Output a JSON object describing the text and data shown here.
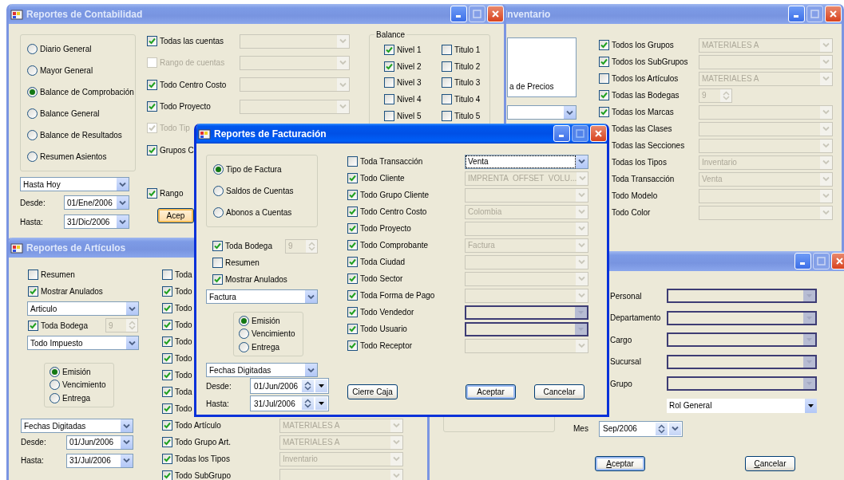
{
  "inventario_window": {
    "title": "Inventario",
    "active": false,
    "list_text": "a de Precios",
    "list_combo": {
      "disabled": false
    },
    "filters": [
      {
        "kind": "check",
        "label": "Todos los Grupos",
        "checked": true,
        "combo": {
          "value": "MATERIALES A",
          "disabled": true
        }
      },
      {
        "kind": "check",
        "label": "Todos los SubGrupos",
        "checked": true,
        "combo": {
          "disabled": true
        }
      },
      {
        "kind": "check",
        "label": "Todos los Artículos",
        "checked": false,
        "combo": {
          "value": "MATERIALES A",
          "disabled": true
        }
      },
      {
        "kind": "check",
        "label": "Todas las Bodegas",
        "checked": true,
        "spin": "9"
      },
      {
        "kind": "check",
        "label": "Todas los Marcas",
        "checked": true,
        "combo": {
          "disabled": true
        }
      },
      {
        "kind": "label",
        "label": "Todas las Clases",
        "combo": {
          "disabled": true
        }
      },
      {
        "kind": "label",
        "label": "Todas las Secciones",
        "combo": {
          "disabled": true
        }
      },
      {
        "kind": "label",
        "label": "Todas los Tipos",
        "combo": {
          "value": "Inventario",
          "disabled": true
        }
      },
      {
        "kind": "label",
        "label": "Toda Transacción",
        "combo": {
          "value": "Venta",
          "disabled": true
        }
      },
      {
        "kind": "label",
        "label": "Todo Modelo",
        "combo": {
          "disabled": true
        }
      },
      {
        "kind": "label",
        "label": "Todo Color",
        "combo": {
          "disabled": true
        }
      }
    ]
  },
  "contabilidad_window": {
    "title": "Reportes de Contabilidad",
    "active": false,
    "report_types": [
      {
        "label": "Diario General",
        "selected": false
      },
      {
        "label": "Mayor General",
        "selected": false
      },
      {
        "label": "Balance de Comprobación",
        "selected": true
      },
      {
        "label": "Balance General",
        "selected": false
      },
      {
        "label": "Balance de Resultados",
        "selected": false
      },
      {
        "label": "Resumen Asientos",
        "selected": false
      }
    ],
    "period": {
      "value": "Hasta Hoy",
      "disabled": false
    },
    "desde_label": "Desde:",
    "desde": {
      "value": "01/Ene/2006",
      "disabled": false
    },
    "hasta_label": "Hasta:",
    "hasta": {
      "value": "31/Dic/2006",
      "disabled": false
    },
    "filters": [
      {
        "label": "Todas las cuentas",
        "checked": true,
        "disabled": false,
        "combo": {
          "disabled": true
        }
      },
      {
        "label": "Rango de cuentas",
        "checked": false,
        "disabled": true,
        "combo": {
          "disabled": true
        }
      },
      {
        "label": "Todo Centro Costo",
        "checked": true,
        "disabled": false,
        "combo": {
          "disabled": true
        }
      },
      {
        "label": "Todo Proyecto",
        "checked": true,
        "disabled": false,
        "combo": {
          "disabled": true
        }
      },
      {
        "label": "Todo Tip",
        "checked": true,
        "disabled": true
      },
      {
        "label": "Grupos C",
        "checked": true,
        "disabled": false
      }
    ],
    "rango": {
      "label": "Rango",
      "checked": true
    },
    "accept_button": {
      "label": "Acep",
      "hover": true
    },
    "balance": {
      "legend": "Balance",
      "niveles": [
        {
          "label": "Nivel 1",
          "checked": true
        },
        {
          "label": "Nivel 2",
          "checked": true
        },
        {
          "label": "Nivel 3",
          "checked": false
        },
        {
          "label": "Nivel 4",
          "checked": false
        },
        {
          "label": "Nivel 5",
          "checked": false
        }
      ],
      "titulos": [
        {
          "label": "Titulo 1",
          "checked": false
        },
        {
          "label": "Titulo 2",
          "checked": false
        },
        {
          "label": "Titulo 3",
          "checked": false
        },
        {
          "label": "Titulo 4",
          "checked": false
        },
        {
          "label": "Titulo 5",
          "checked": false
        }
      ]
    }
  },
  "articulos_window": {
    "title": "Reportes de Artículos",
    "active": false,
    "options": [
      {
        "label": "Resumen",
        "checked": false
      },
      {
        "label": "Mostrar Anulados",
        "checked": true
      }
    ],
    "group_by": {
      "value": "Articulo",
      "disabled": false
    },
    "bodega": {
      "label": "Toda Bodega",
      "checked": true,
      "spin": "9"
    },
    "impuesto": {
      "value": "Todo Impuesto",
      "disabled": false
    },
    "date_basis": [
      {
        "label": "Emisión",
        "selected": true
      },
      {
        "label": "Vencimiento",
        "selected": false
      },
      {
        "label": "Entrega",
        "selected": false
      }
    ],
    "date_mode": {
      "value": "Fechas Digitadas",
      "disabled": false
    },
    "desde_label": "Desde:",
    "desde": {
      "value": "01/Jun/2006",
      "disabled": false
    },
    "hasta_label": "Hasta:",
    "hasta": {
      "value": "31/Jul/2006",
      "disabled": false
    },
    "filters": [
      {
        "label": "Toda",
        "checked": false
      },
      {
        "label": "Todo",
        "checked": true
      },
      {
        "label": "Todo",
        "checked": true
      },
      {
        "label": "Todo",
        "checked": true
      },
      {
        "label": "Todo",
        "checked": true
      },
      {
        "label": "Todo",
        "checked": true
      },
      {
        "label": "Todo",
        "checked": true
      },
      {
        "label": "Toda",
        "checked": true
      },
      {
        "label": "Todo",
        "checked": true
      },
      {
        "label": "Todo Artículo",
        "checked": true,
        "combo": {
          "value": "MATERIALES A",
          "disabled": true
        }
      },
      {
        "label": "Todo Grupo Art.",
        "checked": true,
        "combo": {
          "value": "MATERIALES A",
          "disabled": true
        }
      },
      {
        "label": "Todas los Tipos",
        "checked": true,
        "combo": {
          "value": "Inventario",
          "disabled": true
        }
      },
      {
        "label": "Todo SubGrupo",
        "checked": true,
        "combo": {
          "disabled": true
        }
      }
    ]
  },
  "personal_window": {
    "active": false,
    "fields": [
      {
        "label": "Personal",
        "combo": {
          "locked": true
        }
      },
      {
        "label": "Departamento",
        "combo": {
          "locked": true
        }
      },
      {
        "label": "Cargo",
        "combo": {
          "locked": true
        }
      },
      {
        "label": "Sucursal",
        "combo": {
          "locked": true
        }
      },
      {
        "label": "Grupo",
        "combo": {
          "locked": true
        }
      }
    ],
    "rol": {
      "value": "Rol General",
      "disabled": false
    },
    "mes_label": "Mes",
    "mes": "Sep/2006",
    "buttons": [
      {
        "label": "Aceptar",
        "default": true
      },
      {
        "label": "Cancelar",
        "default": false
      }
    ]
  },
  "facturacion_window": {
    "title": "Reportes de Facturación",
    "active": true,
    "report_types": [
      {
        "label": "Tipo de Factura",
        "selected": true
      },
      {
        "label": "Saldos de Cuentas",
        "selected": false
      },
      {
        "label": "Abonos a Cuentas",
        "selected": false
      }
    ],
    "bodega": {
      "label": "Toda  Bodega",
      "checked": true,
      "spin": "9"
    },
    "options": [
      {
        "label": "Resumen",
        "checked": false
      },
      {
        "label": "Mostrar Anulados",
        "checked": true
      }
    ],
    "doc_type": {
      "value": "Factura",
      "disabled": false
    },
    "date_basis": [
      {
        "label": "Emisión",
        "selected": true
      },
      {
        "label": "Vencimiento",
        "selected": false
      },
      {
        "label": "Entrega",
        "selected": false
      }
    ],
    "date_mode": {
      "value": "Fechas Digitadas",
      "disabled": false
    },
    "desde_label": "Desde:",
    "desde": "01/Jun/2006",
    "hasta_label": "Hasta:",
    "hasta": "31/Jul/2006",
    "filters": [
      {
        "label": "Toda Transacción",
        "checked": false,
        "combo": {
          "value": "Venta",
          "disabled": false,
          "locked": false,
          "focused": true
        }
      },
      {
        "label": "Todo Cliente",
        "checked": true,
        "combo": {
          "value": "IMPRENTA  OFFSET  VOLU...",
          "disabled": true,
          "locked": false
        }
      },
      {
        "label": "Todo Grupo Cliente",
        "checked": true,
        "combo": {
          "disabled": true,
          "locked": false
        }
      },
      {
        "label": "Todo Centro Costo",
        "checked": true,
        "combo": {
          "value": "Colombia",
          "disabled": true,
          "locked": false
        }
      },
      {
        "label": "Todo Proyecto",
        "checked": true,
        "combo": {
          "disabled": true,
          "locked": false
        }
      },
      {
        "label": "Todo Comprobante",
        "checked": true,
        "combo": {
          "value": "Factura",
          "disabled": true,
          "locked": false
        }
      },
      {
        "label": "Toda Ciudad",
        "checked": true,
        "combo": {
          "disabled": true,
          "locked": false
        }
      },
      {
        "label": "Todo Sector",
        "checked": true,
        "combo": {
          "disabled": true,
          "locked": false
        }
      },
      {
        "label": "Toda Forma de Pago",
        "checked": true,
        "combo": {
          "disabled": true,
          "locked": false
        }
      },
      {
        "label": "Todo Vendedor",
        "checked": true,
        "combo": {
          "locked": true
        }
      },
      {
        "label": "Todo Usuario",
        "checked": true,
        "combo": {
          "locked": true
        }
      },
      {
        "label": "Todo Receptor",
        "checked": true,
        "combo": {
          "disabled": true,
          "locked": false
        }
      }
    ],
    "buttons": [
      {
        "label": "Cierre Caja",
        "default": false
      },
      {
        "label": "Aceptar",
        "default": true
      },
      {
        "label": "Cancelar",
        "default": false
      }
    ]
  }
}
